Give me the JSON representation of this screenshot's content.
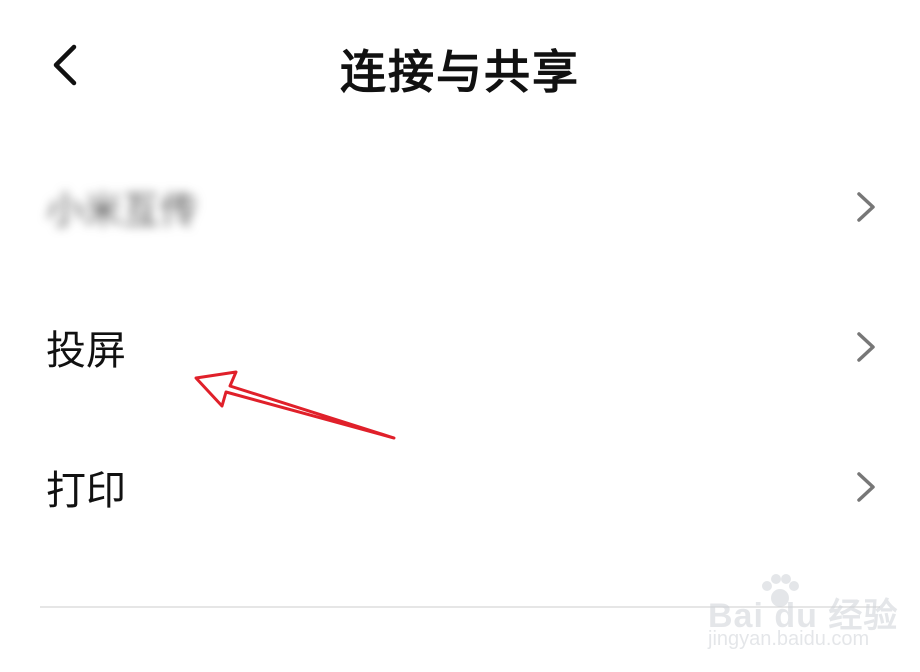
{
  "header": {
    "title": "连接与共享"
  },
  "rows": [
    {
      "label": "小米互传",
      "blurred": true
    },
    {
      "label": "投屏",
      "blurred": false
    },
    {
      "label": "打印",
      "blurred": false
    }
  ],
  "icons": {
    "back": "chevron-left-icon",
    "row_chevron": "chevron-right-icon"
  },
  "colors": {
    "annotation_arrow": "#e0202a",
    "chevron": "#777777"
  },
  "watermark": {
    "logo": "Bai du 经验",
    "site": "jingyan.baidu.com"
  }
}
